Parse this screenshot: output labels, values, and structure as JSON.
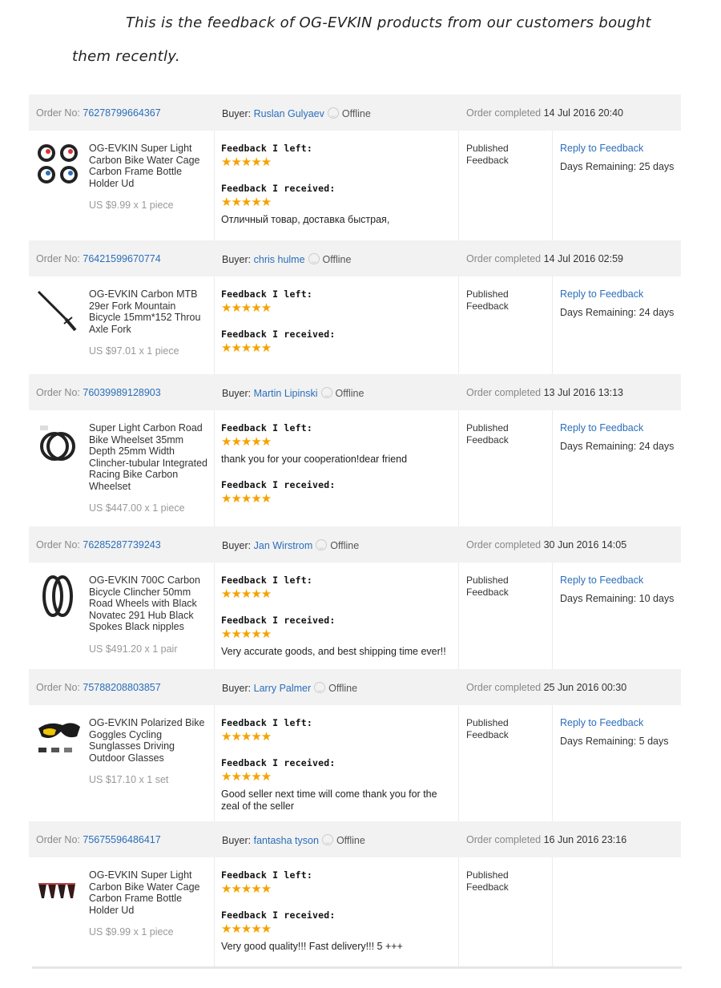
{
  "intro": {
    "line1": "This is the feedback of OG-EVKIN products from our customers bought",
    "line2": "them recently."
  },
  "labels": {
    "order_no": "Order No:",
    "buyer": "Buyer:",
    "order_completed": "Order completed",
    "feedback_left": "Feedback I left:",
    "feedback_received": "Feedback I received:",
    "published": "Published Feedback",
    "stars": "★★★★★"
  },
  "colors": {
    "link": "#2a6ebb",
    "star": "#f5a300",
    "header_bg": "#f2f2f2"
  },
  "orders": [
    {
      "order_no": "76278799664367",
      "buyer": "Ruslan Gulyaev",
      "buyer_status": "Offline",
      "completed": "14 Jul 2016 20:40",
      "product_icon": "water-bottle-cages-image",
      "product_title": "OG-EVKIN Super Light Carbon Bike Water Cage Carbon Frame Bottle Holder Ud",
      "price": "US $9.99 x 1 piece",
      "left_comment": "",
      "received_comment": "Отличный товар, доставка быстрая,",
      "reply": "Reply to Feedback",
      "days": "Days Remaining: 25 days"
    },
    {
      "order_no": "76421599670774",
      "buyer": "chris hulme",
      "buyer_status": "Offline",
      "completed": "14 Jul 2016 02:59",
      "product_icon": "bike-fork-image",
      "product_title": "OG-EVKIN Carbon MTB 29er Fork Mountain Bicycle 15mm*152 Throu Axle Fork",
      "price": "US $97.01 x 1 piece",
      "left_comment": "",
      "received_comment": "",
      "reply": "Reply to Feedback",
      "days": "Days Remaining: 24 days"
    },
    {
      "order_no": "76039989128903",
      "buyer": "Martin Lipinski",
      "buyer_status": "Offline",
      "completed": "13 Jul 2016 13:13",
      "product_icon": "wheelset-image",
      "product_title": "Super Light Carbon Road Bike Wheelset 35mm Depth 25mm Width Clincher-tubular Integrated Racing Bike Carbon Wheelset",
      "price": "US $447.00 x 1 piece",
      "left_comment": "thank you for your cooperation!dear friend",
      "received_comment": "",
      "reply": "Reply to Feedback",
      "days": "Days Remaining: 24 days"
    },
    {
      "order_no": "76285287739243",
      "buyer": "Jan Wirstrom",
      "buyer_status": "Offline",
      "completed": "30 Jun 2016 14:05",
      "product_icon": "wheels-image",
      "product_title": "OG-EVKIN 700C Carbon Bicycle Clincher 50mm Road Wheels with Black Novatec 291 Hub Black Spokes Black nipples",
      "price": "US $491.20 x 1 pair",
      "left_comment": "",
      "received_comment": "Very accurate goods, and best shipping time ever!!",
      "reply": "Reply to Feedback",
      "days": "Days Remaining: 10 days"
    },
    {
      "order_no": "75788208803857",
      "buyer": "Larry Palmer",
      "buyer_status": "Offline",
      "completed": "25 Jun 2016 00:30",
      "product_icon": "sunglasses-image",
      "product_title": "OG-EVKIN Polarized Bike Goggles Cycling Sunglasses Driving Outdoor Glasses",
      "price": "US $17.10 x 1 set",
      "left_comment": "",
      "received_comment": "Good seller next time will come thank you for the zeal of the seller",
      "reply": "Reply to Feedback",
      "days": "Days Remaining: 5 days"
    },
    {
      "order_no": "75675596486417",
      "buyer": "fantasha tyson",
      "buyer_status": "Offline",
      "completed": "16 Jun 2016 23:16",
      "product_icon": "saddles-image",
      "product_title": "OG-EVKIN Super Light Carbon Bike Water Cage Carbon Frame Bottle Holder Ud",
      "price": "US $9.99 x 1 piece",
      "left_comment": "",
      "received_comment": "Very good quality!!! Fast delivery!!! 5 +++",
      "reply": "",
      "days": ""
    }
  ]
}
